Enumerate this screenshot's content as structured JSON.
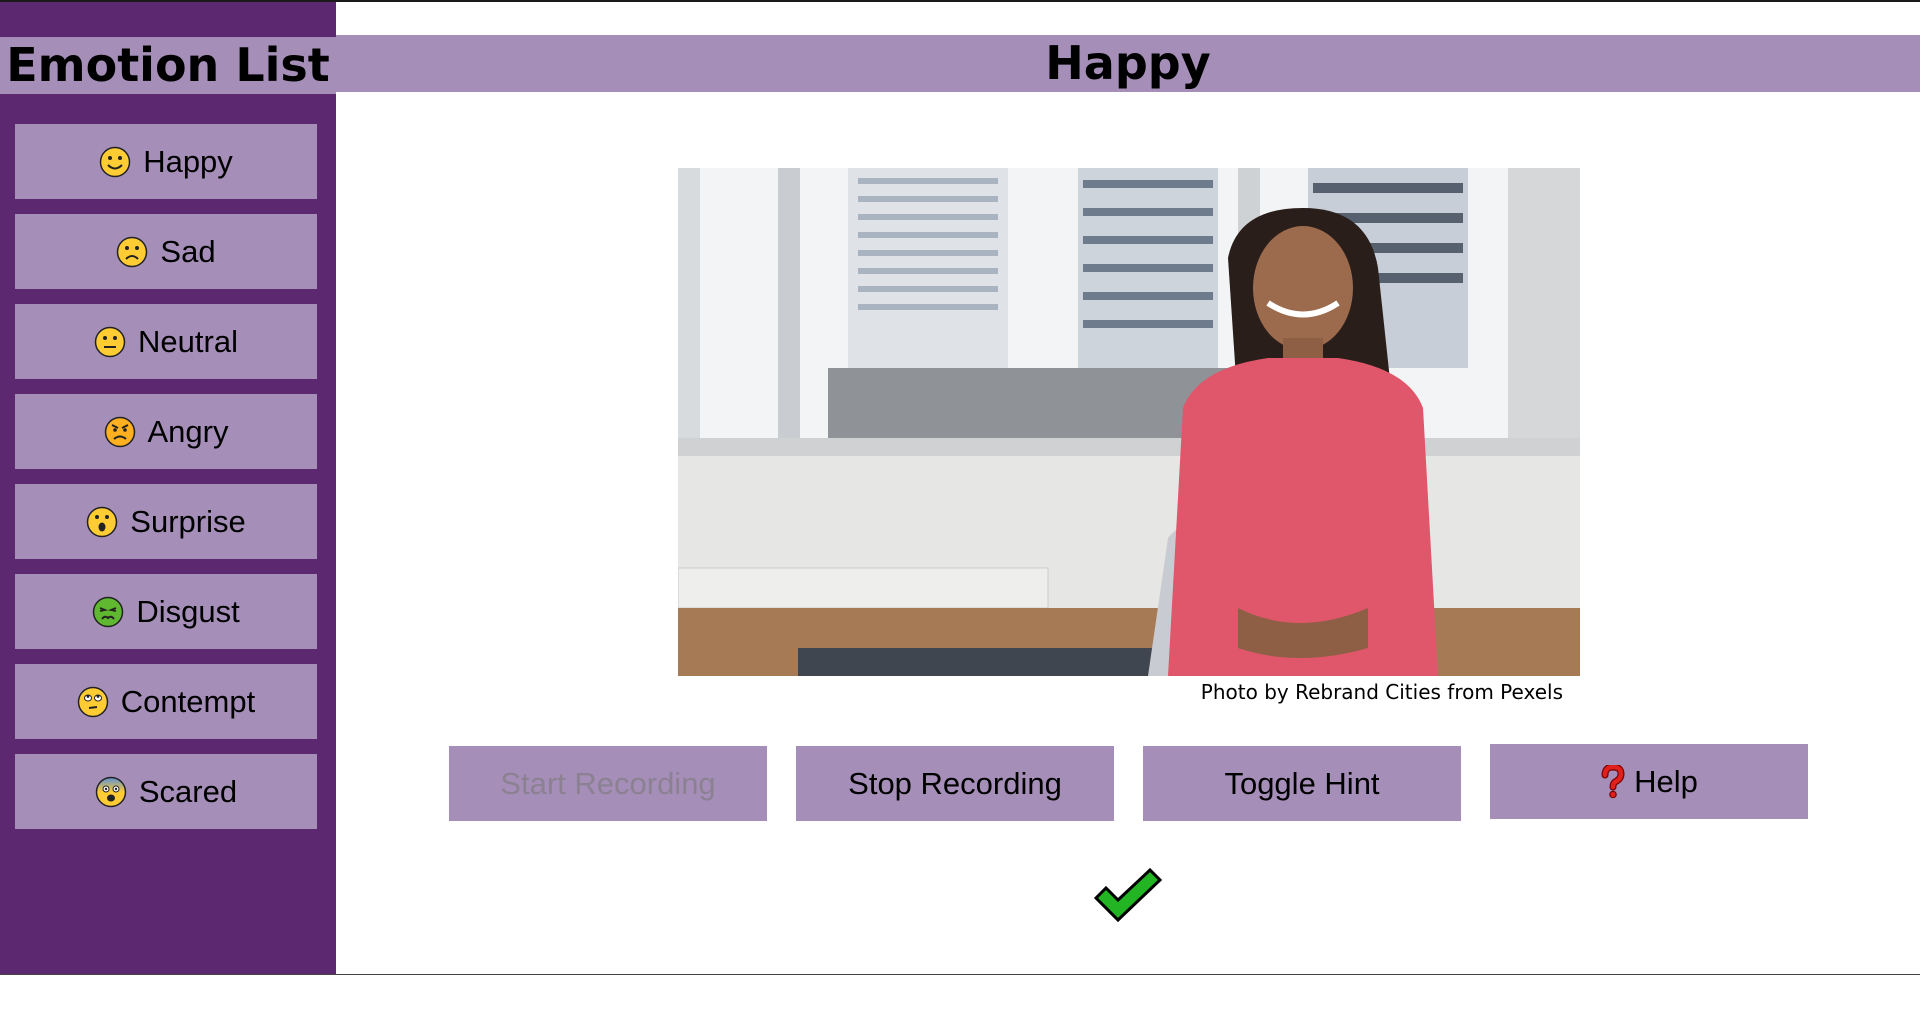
{
  "sidebar": {
    "title": "Emotion List",
    "items": [
      {
        "label": "Happy",
        "icon": "happy-face-icon"
      },
      {
        "label": "Sad",
        "icon": "sad-face-icon"
      },
      {
        "label": "Neutral",
        "icon": "neutral-face-icon"
      },
      {
        "label": "Angry",
        "icon": "angry-face-icon"
      },
      {
        "label": "Surprise",
        "icon": "surprise-face-icon"
      },
      {
        "label": "Disgust",
        "icon": "disgust-face-icon"
      },
      {
        "label": "Contempt",
        "icon": "contempt-face-icon"
      },
      {
        "label": "Scared",
        "icon": "scared-face-icon"
      }
    ]
  },
  "main": {
    "emotion_title": "Happy",
    "photo_credit": "Photo by Rebrand Cities from Pexels",
    "buttons": {
      "start_recording": "Start Recording",
      "stop_recording": "Stop Recording",
      "toggle_hint": "Toggle Hint",
      "help": "Help"
    },
    "result_icon": "green-checkmark-icon"
  },
  "colors": {
    "sidebar_bg": "#5c2870",
    "button_bg": "#a58fb8",
    "disabled_text": "#8b8192",
    "check_green": "#22b422"
  }
}
